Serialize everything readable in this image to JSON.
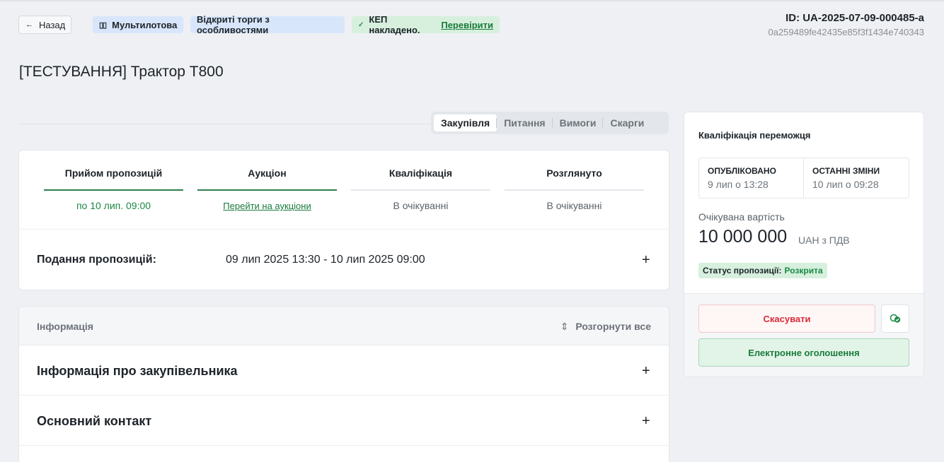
{
  "header": {
    "back_label": "Назад",
    "back_icon": "arrow-left-icon",
    "badges": {
      "multi_lot": "Мультилотова",
      "open_tender": "Відкриті торги з особливостями",
      "kep_text": "КЕП накладено.",
      "kep_link": "Перевірити"
    },
    "tender_id": "ID: UA-2025-07-09-000485-a",
    "tender_hash": "0a259489fe42435e85f3f1434e740343"
  },
  "title": "[ТЕСТУВАННЯ] Трактор Т800",
  "tabs": [
    "Закупівля",
    "Питання",
    "Вимоги",
    "Скарги"
  ],
  "active_tab": "Закупівля",
  "stages": [
    {
      "name": "Прийом пропозицій",
      "sub": "по 10 лип. 09:00",
      "state": "done"
    },
    {
      "name": "Аукціон",
      "sub": "Перейти на аукціони",
      "state": "done"
    },
    {
      "name": "Кваліфікація",
      "sub": "В очікуванні",
      "state": "pending"
    },
    {
      "name": "Розглянуто",
      "sub": "В очікуванні",
      "state": "pending"
    }
  ],
  "submission": {
    "label": "Подання пропозицій:",
    "range": "09 лип 2025 13:30 - 10 лип 2025 09:00"
  },
  "info": {
    "header_label": "Інформація",
    "expand_all": "Розгорнути все",
    "sections": [
      "Інформація про закупівельника",
      "Основний контакт"
    ]
  },
  "sidebar": {
    "title": "Кваліфікація переможця",
    "published_label": "ОПУБЛІКОВАНО",
    "published_value": "9 лип о 13:28",
    "changed_label": "ОСТАННІ ЗМІНИ",
    "changed_value": "10 лип о 09:28",
    "expected_label": "Очікувана вартість",
    "expected_value": "10 000 000",
    "expected_currency": "UAH з ПДВ",
    "status_label": "Статус пропозиції:",
    "status_value": "Розкрита",
    "cancel_button": "Скасувати",
    "notice_button": "Електронне оголошення"
  },
  "colors": {
    "accent_green": "#2e7d4f",
    "badge_blue": "#d8e6fb",
    "badge_green": "#d6f0dd",
    "danger_red": "#d92b3a"
  }
}
